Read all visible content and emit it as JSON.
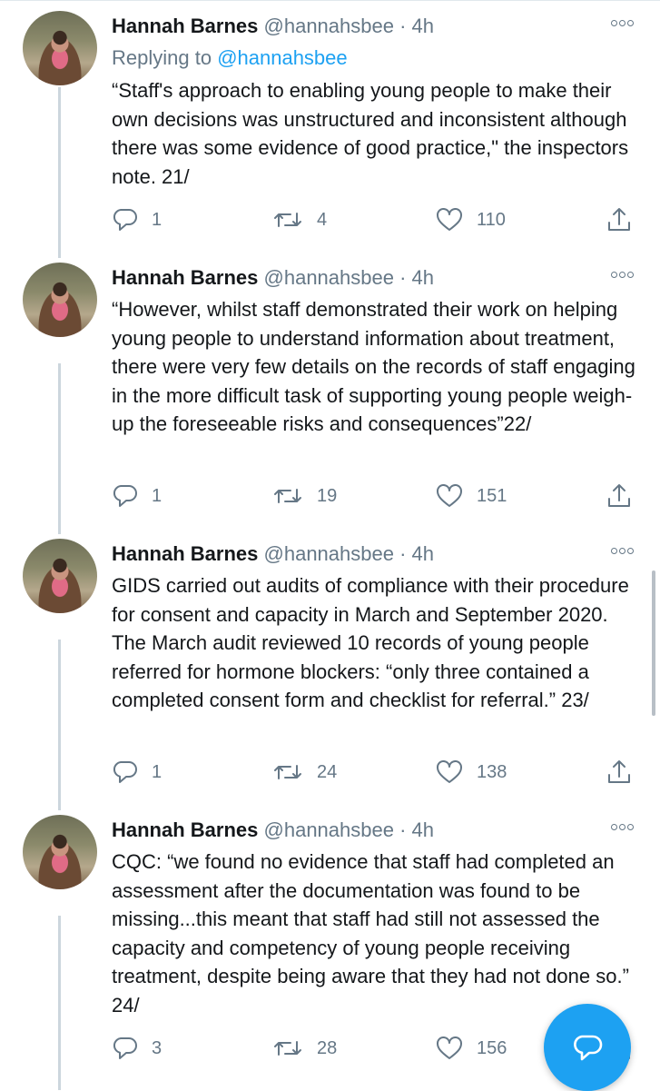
{
  "tweets": [
    {
      "name": "Hannah Barnes",
      "handle": "@hannahsbee",
      "dot": "·",
      "time": "4h",
      "replying_prefix": "Replying to ",
      "replying_to": "@hannahsbee",
      "text": "“Staff's approach to enabling young people to make their own decisions was unstructured and inconsistent although there was some evidence of good practice,\" the inspectors note. 21/",
      "replies": "1",
      "retweets": "4",
      "likes": "110"
    },
    {
      "name": "Hannah Barnes",
      "handle": "@hannahsbee",
      "dot": "·",
      "time": "4h",
      "text": "“However, whilst staff demonstrated their work on helping young people to understand information about treatment, there were very few details on the records of staff engaging in the more difficult task of supporting young people weigh-up the foreseeable risks and consequences”22/",
      "replies": "1",
      "retweets": "19",
      "likes": "151"
    },
    {
      "name": "Hannah Barnes",
      "handle": "@hannahsbee",
      "dot": "·",
      "time": "4h",
      "text": "GIDS carried out audits of compliance with their procedure for consent and capacity in March and September 2020. The March audit reviewed 10 records of young people referred for hormone blockers: “only three contained a completed consent form and checklist for referral.” 23/",
      "replies": "1",
      "retweets": "24",
      "likes": "138"
    },
    {
      "name": "Hannah Barnes",
      "handle": "@hannahsbee",
      "dot": "·",
      "time": "4h",
      "text": "CQC: “we found no evidence that staff had completed an assessment after the documentation was found to be missing...this meant that staff had still not assessed the capacity and competency of young people receiving treatment, despite being aware that they had not done so.” 24/",
      "replies": "3",
      "retweets": "28",
      "likes": "156"
    }
  ],
  "icons": {
    "reply": "reply-icon",
    "retweet": "retweet-icon",
    "like": "heart-icon",
    "share": "share-icon",
    "more": "more-icon",
    "compose": "compose-reply-icon"
  },
  "colors": {
    "accent": "#1da1f2",
    "secondary_text": "#657786",
    "primary_text": "#14171a",
    "thread_line": "#ccd6dd"
  }
}
